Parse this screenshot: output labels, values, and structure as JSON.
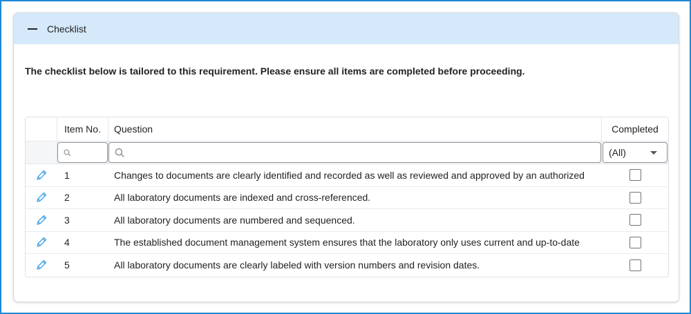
{
  "panel": {
    "title": "Checklist",
    "collapse_icon": "minus-icon",
    "instruction": "The checklist below is tailored to this requirement. Please ensure all items are completed before proceeding."
  },
  "grid": {
    "columns": {
      "edit": "",
      "item_no": "Item No.",
      "question": "Question",
      "completed": "Completed"
    },
    "filters": {
      "item_no_placeholder": "",
      "question_placeholder": "",
      "completed_selected": "(All)",
      "search_icon": "search-icon"
    },
    "rows": [
      {
        "item_no": "1",
        "question": "Changes to documents are clearly identified and recorded as well as reviewed and approved by an authorized",
        "completed": false
      },
      {
        "item_no": "2",
        "question": "All laboratory documents are indexed and cross-referenced.",
        "completed": false
      },
      {
        "item_no": "3",
        "question": "All laboratory documents are numbered and sequenced.",
        "completed": false
      },
      {
        "item_no": "4",
        "question": "The established document management system ensures that the laboratory only uses current and up-to-date",
        "completed": false
      },
      {
        "item_no": "5",
        "question": "All laboratory documents are clearly labeled with version numbers and revision dates.",
        "completed": false
      }
    ],
    "edit_icon": "pencil-icon",
    "colors": {
      "edit_icon": "#3aa0e8",
      "header_bg": "#d5e9fb",
      "border": "#1e88d6"
    }
  }
}
